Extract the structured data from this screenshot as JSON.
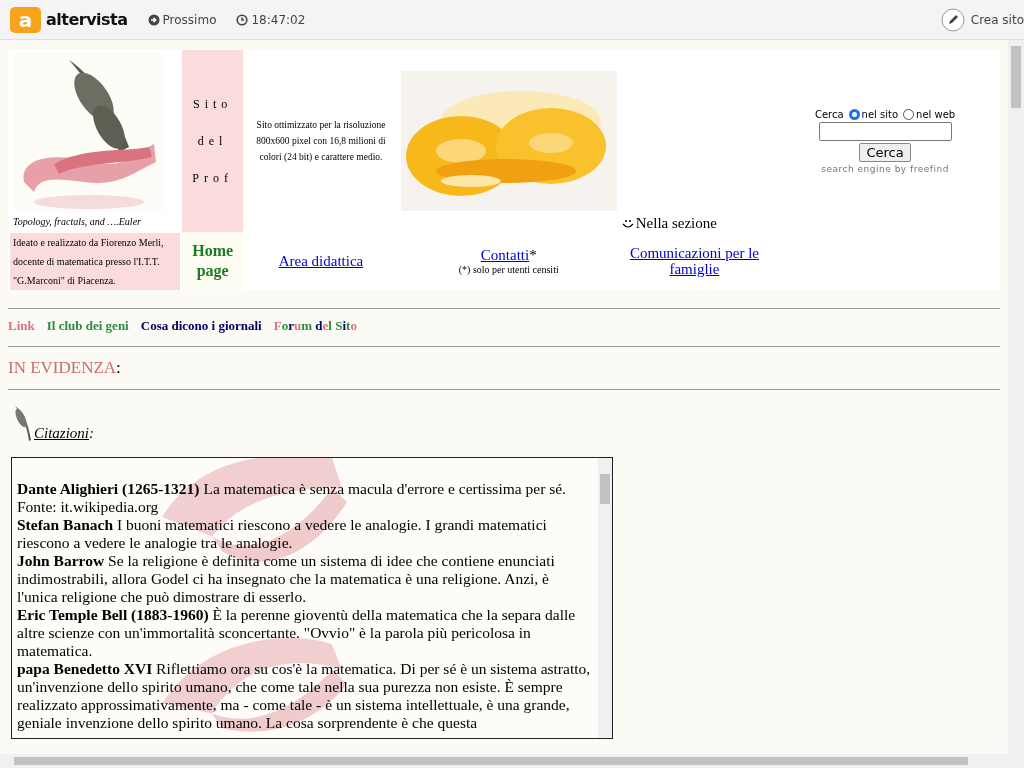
{
  "topbar": {
    "logo_letter": "a",
    "brand": "altervista",
    "next": "Prossimo",
    "time": "18:47:02",
    "create": "Crea sito"
  },
  "header": {
    "caption": "Topology, fractals, and  ….Euler",
    "title_words": [
      "Sito",
      "del",
      "Prof"
    ],
    "resolution_note": "Sito ottimizzato per la risoluzione 800x600 pixel con 16,8 milioni di colori (24 bit) e carattere medio.",
    "section_note": "Nella sezione",
    "credit": "Ideato e realizzato da Fiorenzo Merli, docente di matematica presso l'I.T.T. \"G.Marconi\" di Piacenza.",
    "home": "Home page",
    "area": "Area didattica",
    "contacts": "Contatti",
    "contacts_mark": "*",
    "contacts_note": "(*) solo per utenti censiti",
    "families": "Comunicazioni per le famiglie"
  },
  "search": {
    "label": "Cerca",
    "options": [
      {
        "label": "nel sito",
        "selected": true
      },
      {
        "label": "nel web",
        "selected": false
      }
    ],
    "button": "Cerca",
    "credit": "search engine by freefind"
  },
  "links": [
    {
      "label": "Link",
      "color": "#d9737f"
    },
    {
      "label": "Il club dei geni",
      "color": "#2e8b3e"
    },
    {
      "label": "Cosa dicono i giornali",
      "color": "#000066"
    }
  ],
  "forum": [
    {
      "text": "F",
      "color": "#d9737f"
    },
    {
      "text": "o",
      "color": "#2e8b3e"
    },
    {
      "text": "r",
      "color": "#000066"
    },
    {
      "text": "u",
      "color": "#d9737f"
    },
    {
      "text": "m ",
      "color": "#2e8b3e"
    },
    {
      "text": "d",
      "color": "#000066"
    },
    {
      "text": "e",
      "color": "#d9737f"
    },
    {
      "text": "l ",
      "color": "#2e8b3e"
    },
    {
      "text": "S",
      "color": "#2e8b3e"
    },
    {
      "text": "i",
      "color": "#000066"
    },
    {
      "text": "t",
      "color": "#2e8b3e"
    },
    {
      "text": "o",
      "color": "#d9737f"
    }
  ],
  "highlight": {
    "title": "IN EVIDENZA",
    "colon": ":"
  },
  "quotes_section": {
    "title": "Citazioni",
    "colon": ":"
  },
  "quotes": [
    {
      "author": "Dante Alighieri (1265-1321)",
      "text": "La matematica è senza macula d'errore e certissima per sé. Fonte: it.wikipedia.org"
    },
    {
      "author": "Stefan Banach",
      "text": "I buoni matematici riescono a vedere le analogie. I grandi matematici riescono a vedere le analogie tra le analogie."
    },
    {
      "author": "John Barrow",
      "text": "Se la religione è definita come un sistema di idee che contiene enunciati indimostrabili, allora Godel ci ha insegnato che la matematica è una religione. Anzi, è l'unica religione che può dimostrare di esserlo."
    },
    {
      "author": "Eric Temple Bell (1883-1960)",
      "text": "È la perenne gioventù della matematica che la separa dalle altre scienze con un'immortalità sconcertante. \"Ovvio\" è la parola più pericolosa in matematica."
    },
    {
      "author": "papa Benedetto XVI",
      "text": "Riflettiamo ora su cos'è la matematica. Di per sé è un sistema astratto, un'invenzione dello spirito umano, che come tale nella sua purezza non esiste. È sempre realizzato approssimativamente, ma - come tale - è un sistema intellettuale, è una grande, geniale invenzione dello spirito umano. La cosa sorprendente è che questa"
    }
  ]
}
